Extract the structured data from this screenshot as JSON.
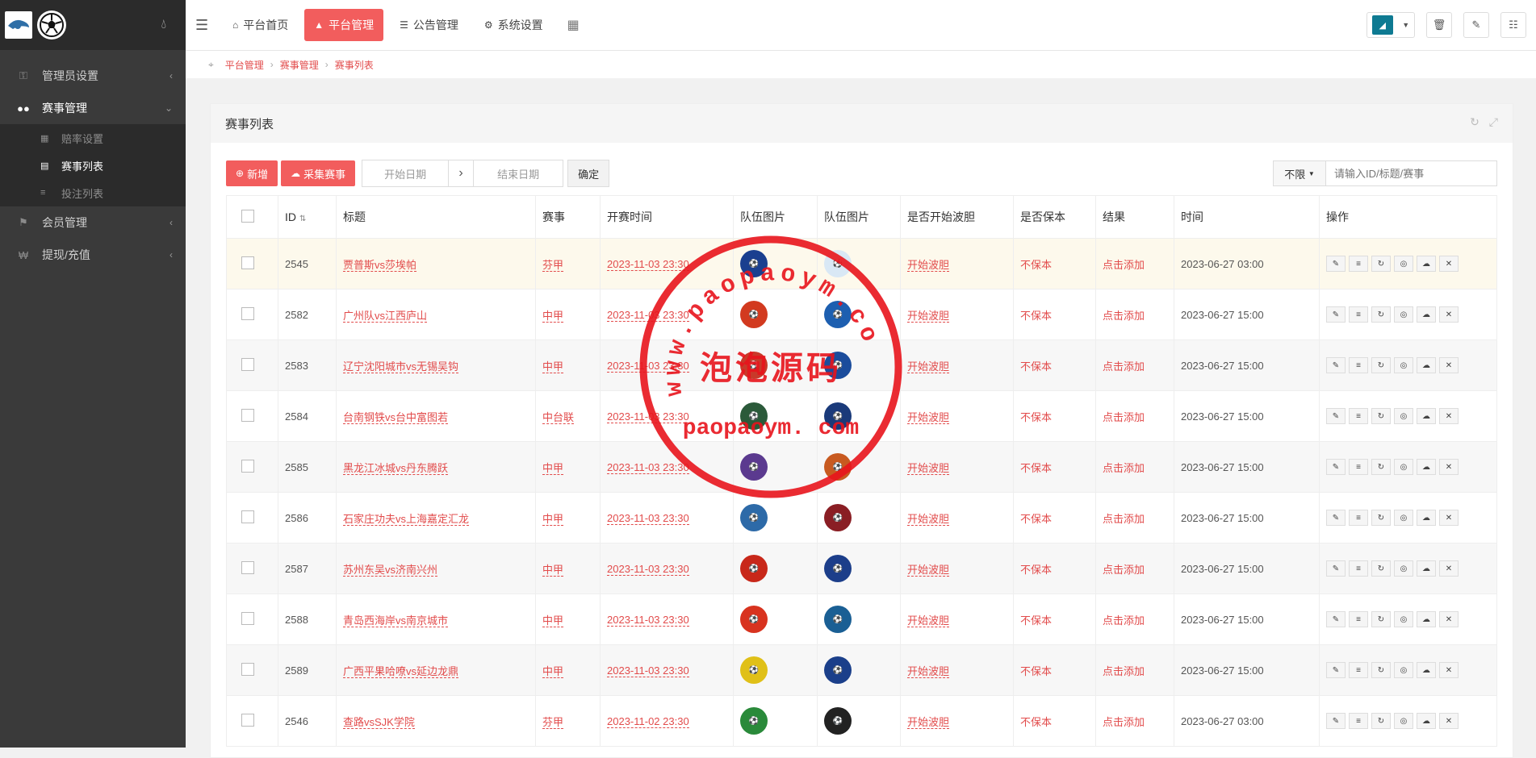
{
  "sidebar": {
    "items": [
      {
        "label": "管理员设置",
        "icon": "key-icon",
        "active": false
      },
      {
        "label": "赛事管理",
        "icon": "users-icon",
        "active": true
      },
      {
        "label": "会员管理",
        "icon": "trophy-icon",
        "active": false
      },
      {
        "label": "提现/充值",
        "icon": "won-icon",
        "active": false
      }
    ],
    "subitems": [
      {
        "label": "赔率设置",
        "active": false
      },
      {
        "label": "赛事列表",
        "active": true
      },
      {
        "label": "投注列表",
        "active": false
      }
    ]
  },
  "topbar": {
    "tabs": [
      {
        "label": "平台首页",
        "active": false
      },
      {
        "label": "平台管理",
        "active": true
      },
      {
        "label": "公告管理",
        "active": false
      },
      {
        "label": "系统设置",
        "active": false
      }
    ]
  },
  "breadcrumb": [
    "平台管理",
    "赛事管理",
    "赛事列表"
  ],
  "panel": {
    "title": "赛事列表",
    "add_label": "新增",
    "collect_label": "采集赛事",
    "start_date_placeholder": "开始日期",
    "end_date_placeholder": "结束日期",
    "ok_label": "确定",
    "filter_select": "不限",
    "search_placeholder": "请输入ID/标题/赛事"
  },
  "table": {
    "headers": [
      "ID",
      "标题",
      "赛事",
      "开赛时间",
      "队伍图片",
      "队伍图片",
      "是否开始波胆",
      "是否保本",
      "结果",
      "时间",
      "操作"
    ],
    "rows": [
      {
        "id": "2545",
        "title": "贾普斯vs莎埃帕",
        "league": "芬甲",
        "start": "2023-11-03 23:30",
        "bodan": "开始波胆",
        "baoben": "不保本",
        "result": "点击添加",
        "time": "2023-06-27 03:00"
      },
      {
        "id": "2582",
        "title": "广州队vs江西庐山",
        "league": "中甲",
        "start": "2023-11-03 23:30",
        "bodan": "开始波胆",
        "baoben": "不保本",
        "result": "点击添加",
        "time": "2023-06-27 15:00"
      },
      {
        "id": "2583",
        "title": "辽宁沈阳城市vs无锡吴钩",
        "league": "中甲",
        "start": "2023-11-03 23:30",
        "bodan": "开始波胆",
        "baoben": "不保本",
        "result": "点击添加",
        "time": "2023-06-27 15:00"
      },
      {
        "id": "2584",
        "title": "台南钢铁vs台中富图若",
        "league": "中台联",
        "start": "2023-11-03 23:30",
        "bodan": "开始波胆",
        "baoben": "不保本",
        "result": "点击添加",
        "time": "2023-06-27 15:00"
      },
      {
        "id": "2585",
        "title": "黑龙江冰城vs丹东腾跃",
        "league": "中甲",
        "start": "2023-11-03 23:30",
        "bodan": "开始波胆",
        "baoben": "不保本",
        "result": "点击添加",
        "time": "2023-06-27 15:00"
      },
      {
        "id": "2586",
        "title": "石家庄功夫vs上海嘉定汇龙",
        "league": "中甲",
        "start": "2023-11-03 23:30",
        "bodan": "开始波胆",
        "baoben": "不保本",
        "result": "点击添加",
        "time": "2023-06-27 15:00"
      },
      {
        "id": "2587",
        "title": "苏州东吴vs济南兴州",
        "league": "中甲",
        "start": "2023-11-03 23:30",
        "bodan": "开始波胆",
        "baoben": "不保本",
        "result": "点击添加",
        "time": "2023-06-27 15:00"
      },
      {
        "id": "2588",
        "title": "青岛西海岸vs南京城市",
        "league": "中甲",
        "start": "2023-11-03 23:30",
        "bodan": "开始波胆",
        "baoben": "不保本",
        "result": "点击添加",
        "time": "2023-06-27 15:00"
      },
      {
        "id": "2589",
        "title": "广西平果哈嘹vs延边龙鼎",
        "league": "中甲",
        "start": "2023-11-03 23:30",
        "bodan": "开始波胆",
        "baoben": "不保本",
        "result": "点击添加",
        "time": "2023-06-27 15:00"
      },
      {
        "id": "2546",
        "title": "查路vsSJK学院",
        "league": "芬甲",
        "start": "2023-11-02 23:30",
        "bodan": "开始波胆",
        "baoben": "不保本",
        "result": "点击添加",
        "time": "2023-06-27 03:00"
      }
    ],
    "team_colors": [
      [
        "#1a3f8f",
        "#d9e8f5"
      ],
      [
        "#d23a1f",
        "#1d5fb0"
      ],
      [
        "#c83a2a",
        "#1b4c9c"
      ],
      [
        "#2b5a3a",
        "#1a3a7a"
      ],
      [
        "#5b3a8f",
        "#c85a20"
      ],
      [
        "#2d6aa8",
        "#8a1e24"
      ],
      [
        "#c8281a",
        "#1c3e8a"
      ],
      [
        "#d8331f",
        "#1a5f94"
      ],
      [
        "#e0c018",
        "#1b3f8a"
      ],
      [
        "#2a8a3a",
        "#222222"
      ]
    ]
  },
  "stamp": {
    "arc_text": "www.paopaoym.com",
    "center_text": "泡泡源码",
    "bottom_text": "paopaoym. com",
    "color": "#e8141c"
  },
  "colors": {
    "accent": "#f25d5d",
    "link": "#e24b4b",
    "sidebar": "#3a3a3a"
  }
}
